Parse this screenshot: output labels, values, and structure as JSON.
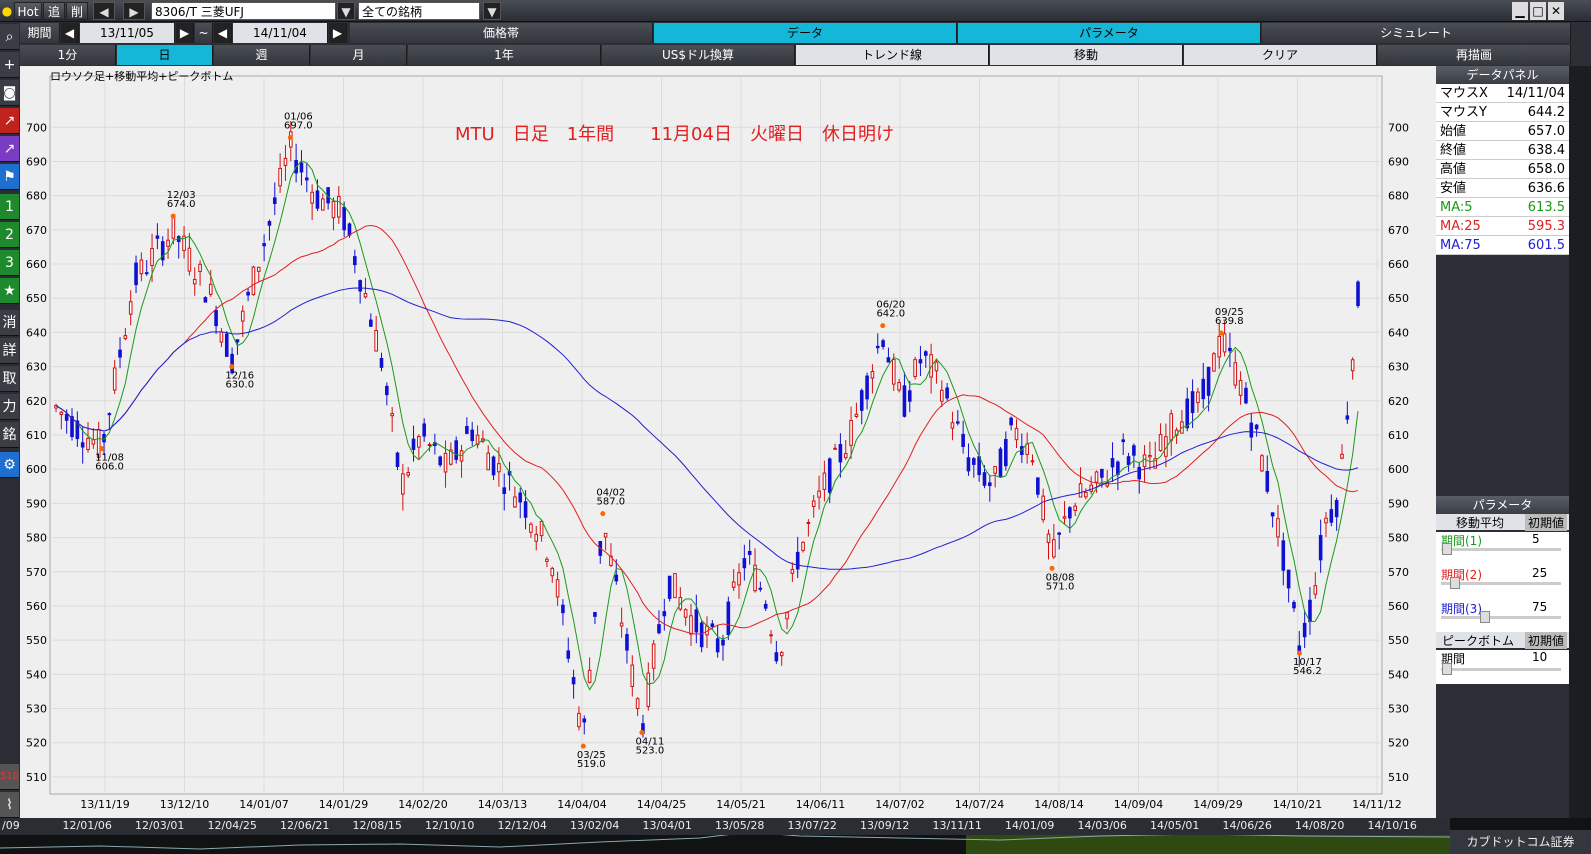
{
  "toolbar": {
    "hot": "Hot",
    "add": "追",
    "del": "削",
    "symbol": "8306/T 三菱UFJ",
    "universe": "全ての銘柄",
    "period_label": "期間",
    "date_from": "13/11/05",
    "tilde": "~",
    "date_to": "14/11/04"
  },
  "row2": {
    "price_band": "価格帯",
    "data": "データ",
    "parameter": "パラメータ",
    "simulate": "シミュレート"
  },
  "row3": {
    "min1": "1分",
    "day": "日",
    "week": "週",
    "month": "月",
    "year1": "1年",
    "usd": "US$ドル換算",
    "trend": "トレンド線",
    "move": "移動",
    "clear": "クリア",
    "redraw": "再描画"
  },
  "sidebar": [
    "消",
    "詳",
    "取",
    "力",
    "銘"
  ],
  "chart": {
    "subtitle": "ロウソク足+移動平均+ピークボトム",
    "annotation": "MTU　日足　1年間　　11月04日　火曜日　休日明け"
  },
  "data_panel": {
    "title": "データパネル",
    "mouse_x_label": "マウスX",
    "mouse_x": "14/11/04",
    "mouse_y_label": "マウスY",
    "mouse_y": "644.2",
    "open_label": "始値",
    "open": "657.0",
    "close_label": "終値",
    "close": "638.4",
    "high_label": "高値",
    "high": "658.0",
    "low_label": "安値",
    "low": "636.6",
    "ma5_label": "MA:5",
    "ma5": "613.5",
    "ma25_label": "MA:25",
    "ma25": "595.3",
    "ma75_label": "MA:75",
    "ma75": "601.5"
  },
  "param_panel": {
    "title": "パラメータ",
    "ma_title": "移動平均",
    "init": "初期値",
    "p1": "期間(1)",
    "v1": "5",
    "p2": "期間(2)",
    "v2": "25",
    "p3": "期間(3)",
    "v3": "75",
    "pb_title": "ピークボトム",
    "init2": "初期値",
    "pb_period": "期間",
    "pb_value": "10"
  },
  "bottom_labels": [
    "/09",
    "12/01/06",
    "12/03/01",
    "12/04/25",
    "12/06/21",
    "12/08/15",
    "12/10/10",
    "12/12/04",
    "13/02/04",
    "13/04/01",
    "13/05/28",
    "13/07/22",
    "13/09/12",
    "13/11/11",
    "14/01/09",
    "14/03/06",
    "14/05/01",
    "14/06/26",
    "14/08/20",
    "14/10/16"
  ],
  "logo": "カブドットコム証券",
  "colors": {
    "up": "#d01010",
    "down": "#1010d0",
    "ma5": "#1a9a1a",
    "ma25": "#e02020",
    "ma75": "#2020d0",
    "peak": "#ff6600",
    "annotation": "#e02020"
  },
  "chart_data": {
    "type": "candlestick",
    "title": "ロウソク足+移動平均+ピークボトム",
    "y_range": [
      505,
      715
    ],
    "y_ticks": [
      510,
      520,
      530,
      540,
      550,
      560,
      570,
      580,
      590,
      600,
      610,
      620,
      630,
      640,
      650,
      660,
      670,
      680,
      690,
      700
    ],
    "x_tick_labels": [
      "13/11/19",
      "13/12/10",
      "14/01/07",
      "14/01/29",
      "14/02/20",
      "14/03/13",
      "14/04/04",
      "14/04/25",
      "14/05/21",
      "14/06/11",
      "14/07/02",
      "14/07/24",
      "14/08/14",
      "14/09/04",
      "14/09/29",
      "14/10/21",
      "14/11/12"
    ],
    "peaks": [
      {
        "date": "11/08",
        "value": "606.0",
        "type": "bottom",
        "x": 0.035
      },
      {
        "date": "12/03",
        "value": "674.0",
        "type": "peak",
        "x": 0.09
      },
      {
        "date": "12/16",
        "value": "630.0",
        "type": "bottom",
        "x": 0.135
      },
      {
        "date": "01/06",
        "value": "697.0",
        "type": "peak",
        "x": 0.18
      },
      {
        "date": "03/25",
        "value": "519.0",
        "type": "bottom",
        "x": 0.405
      },
      {
        "date": "04/02",
        "value": "587.0",
        "type": "peak",
        "x": 0.42
      },
      {
        "date": "04/11",
        "value": "523.0",
        "type": "bottom",
        "x": 0.45
      },
      {
        "date": "06/20",
        "value": "642.0",
        "type": "peak",
        "x": 0.635
      },
      {
        "date": "08/08",
        "value": "571.0",
        "type": "bottom",
        "x": 0.765
      },
      {
        "date": "09/25",
        "value": "639.8",
        "type": "peak",
        "x": 0.895
      },
      {
        "date": "10/17",
        "value": "546.2",
        "type": "bottom",
        "x": 0.955
      }
    ],
    "ma_legend": [
      "MA:5",
      "MA:25",
      "MA:75"
    ]
  }
}
